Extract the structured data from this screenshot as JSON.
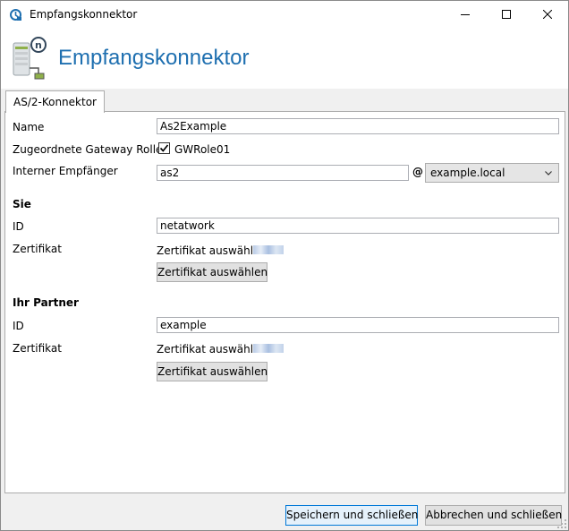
{
  "window": {
    "title": "Empfangskonnektor",
    "minimize_icon": "minimize-icon",
    "maximize_icon": "maximize-icon",
    "close_icon": "close-icon"
  },
  "header": {
    "title": "Empfangskonnektor",
    "icon": "server-connector-icon"
  },
  "tabs": [
    {
      "label": "AS/2-Konnektor",
      "selected": true
    }
  ],
  "form": {
    "name": {
      "label": "Name",
      "value": "As2Example"
    },
    "gateway_roles": {
      "label": "Zugeordnete Gateway Rollen",
      "checkbox_label": "GWRole01",
      "checked": true
    },
    "internal_recipient": {
      "label": "Interner Empfänger",
      "value": "as2",
      "at_symbol": "@",
      "domain": "example.local"
    }
  },
  "sie": {
    "heading": "Sie",
    "id_label": "ID",
    "id_value": "netatwork",
    "cert_label": "Zertifikat",
    "cert_value": "Zertifikat auswählen",
    "cert_button": "Zertifikat auswählen"
  },
  "partner": {
    "heading": "Ihr Partner",
    "id_label": "ID",
    "id_value": "example",
    "cert_label": "Zertifikat",
    "cert_value": "Zertifikat auswählen",
    "cert_button": "Zertifikat auswählen"
  },
  "footer": {
    "save_label": "Speichern und schließen",
    "cancel_label": "Abbrechen und schließen"
  },
  "colors": {
    "accent": "#1e6fb0",
    "window_bg": "#f0f0f0",
    "button_bg": "#e1e1e1"
  }
}
